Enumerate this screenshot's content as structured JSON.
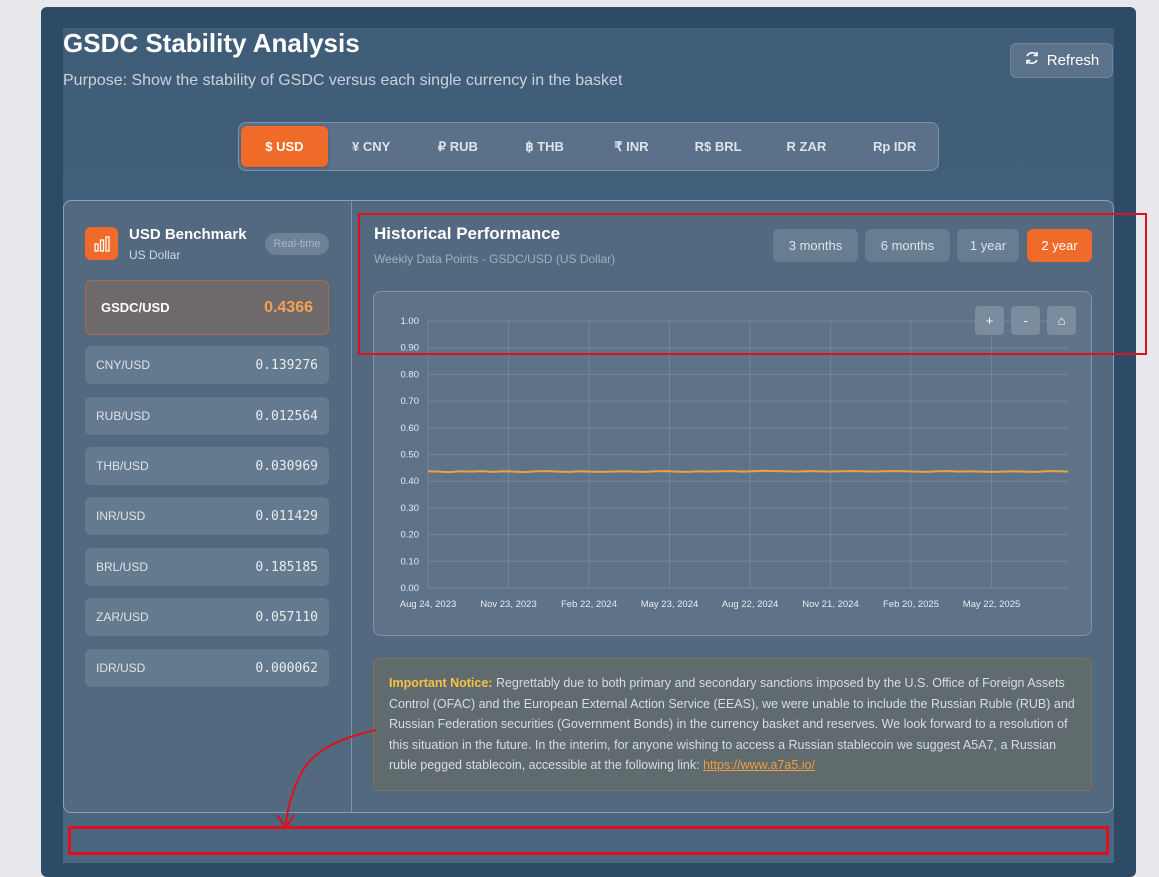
{
  "header": {
    "title": "GSDC Stability Analysis",
    "subtitle": "Purpose: Show the stability of GSDC versus each single currency in the basket",
    "refresh_label": "Refresh"
  },
  "currencies": [
    {
      "symbol": "$",
      "code": "USD"
    },
    {
      "symbol": "¥",
      "code": "CNY"
    },
    {
      "symbol": "₽",
      "code": "RUB"
    },
    {
      "symbol": "฿",
      "code": "THB"
    },
    {
      "symbol": "₹",
      "code": "INR"
    },
    {
      "symbol": "R$",
      "code": "BRL"
    },
    {
      "symbol": "R",
      "code": "ZAR"
    },
    {
      "symbol": "Rp",
      "code": "IDR"
    }
  ],
  "sidebar": {
    "benchmark_title": "USD Benchmark",
    "benchmark_sub": "US Dollar",
    "realtime_badge": "Real-time",
    "main_rate": {
      "label": "GSDC/USD",
      "value": "0.4366"
    },
    "rates": [
      {
        "label": "CNY/USD",
        "value": "0.139276"
      },
      {
        "label": "RUB/USD",
        "value": "0.012564"
      },
      {
        "label": "THB/USD",
        "value": "0.030969"
      },
      {
        "label": "INR/USD",
        "value": "0.011429"
      },
      {
        "label": "BRL/USD",
        "value": "0.185185"
      },
      {
        "label": "ZAR/USD",
        "value": "0.057110"
      },
      {
        "label": "IDR/USD",
        "value": "0.000062"
      }
    ]
  },
  "performance": {
    "title": "Historical Performance",
    "subtitle": "Weekly Data Points - GSDC/USD (US Dollar)",
    "ranges": [
      "3 months",
      "6 months",
      "1 year",
      "2 year"
    ],
    "active_range": "2 year",
    "zoom": {
      "in": "+",
      "out": "-",
      "reset": "⌂"
    }
  },
  "notice": {
    "label": "Important Notice:",
    "text": " Regrettably due to both primary and secondary sanctions imposed by the U.S. Office of Foreign Assets Control (OFAC) and the European External Action Service (EEAS), we were unable to include the Russian Ruble (RUB) and Russian Federation securities (Government Bonds) in the currency basket and reserves. We look forward to a resolution of this situation in the future. In the interim, for anyone wishing to access a Russian stablecoin we suggest A5A7, a Russian ruble pegged stablecoin, accessible at the following link: ",
    "link": "https://www.a7a5.io/"
  },
  "colors": {
    "accent": "#f06a2a",
    "line": "#f0a040",
    "annotation": "#e0101c"
  },
  "chart_data": {
    "type": "line",
    "title": "",
    "xlabel": "",
    "ylabel": "",
    "ylim": [
      0,
      1
    ],
    "yticks": [
      "0.00",
      "0.10",
      "0.20",
      "0.30",
      "0.40",
      "0.50",
      "0.60",
      "0.70",
      "0.80",
      "0.90",
      "1.00"
    ],
    "xticks": [
      "Aug 24, 2023",
      "Nov 23, 2023",
      "Feb 22, 2024",
      "May 23, 2024",
      "Aug 22, 2024",
      "Nov 21, 2024",
      "Feb 20, 2025",
      "May 22, 2025"
    ],
    "grid": true,
    "series": [
      {
        "values": [
          0.437,
          0.436,
          0.434,
          0.437,
          0.436,
          0.438,
          0.435,
          0.437,
          0.436,
          0.434,
          0.437,
          0.438,
          0.436,
          0.435,
          0.437,
          0.436,
          0.435,
          0.436,
          0.437,
          0.436,
          0.435,
          0.437,
          0.438,
          0.436,
          0.435,
          0.437,
          0.436,
          0.437,
          0.438,
          0.436,
          0.437,
          0.439,
          0.438,
          0.437,
          0.436,
          0.438,
          0.437,
          0.436,
          0.437,
          0.438,
          0.437,
          0.436,
          0.437,
          0.438,
          0.437,
          0.436,
          0.435,
          0.437,
          0.438,
          0.436,
          0.437,
          0.436,
          0.435,
          0.436,
          0.437,
          0.436,
          0.435,
          0.437,
          0.438,
          0.436
        ]
      }
    ]
  }
}
